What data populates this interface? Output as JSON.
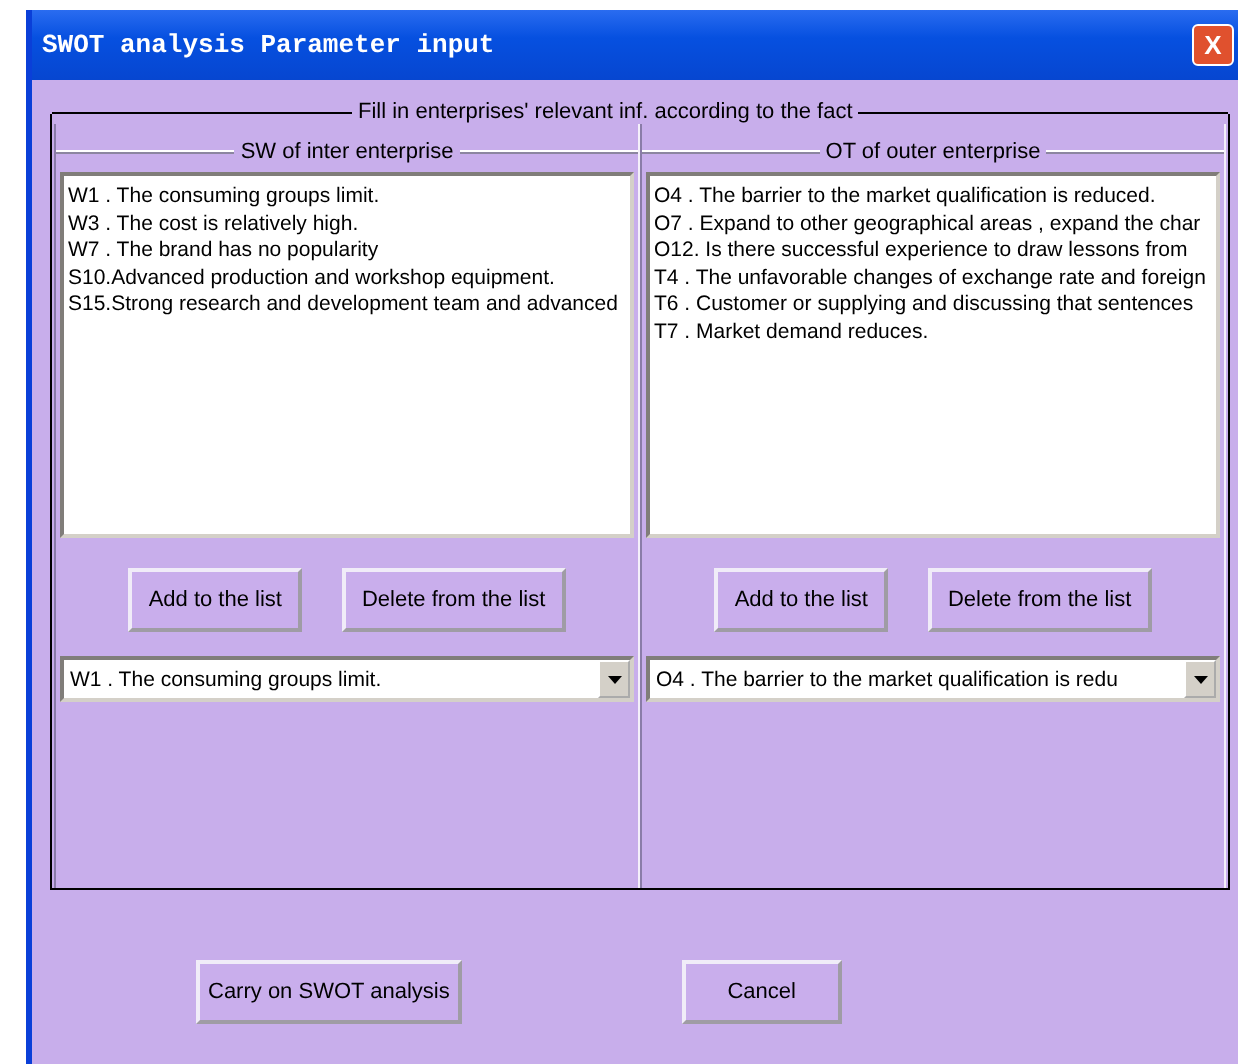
{
  "window": {
    "title": "SWOT analysis Parameter input",
    "close_label": "X"
  },
  "group": {
    "title": "Fill in enterprises' relevant inf. according to the fact"
  },
  "panels": [
    {
      "title": "SW of inter enterprise",
      "items": [
        "W1 . The consuming groups limit.",
        "W3 . The cost is relatively high.",
        "W7 . The brand has no popularity",
        "S10.Advanced production and workshop equipment.",
        "S15.Strong research and development team and advanced"
      ],
      "buttons": [
        "Add to the list",
        "Delete from the list"
      ],
      "combo": {
        "value": "W1 . The consuming groups limit."
      }
    },
    {
      "title": "OT of outer enterprise",
      "items": [
        "O4 . The barrier to the market qualification is reduced.",
        "O7 . Expand to other geographical areas , expand the char",
        "O12. Is there successful experience to draw lessons from",
        "T4 . The unfavorable changes of exchange rate and foreign",
        "T6 . Customer or supplying and discussing that sentences",
        "T7 . Market demand reduces."
      ],
      "buttons": [
        "Add to the list",
        "Delete from the list"
      ],
      "combo": {
        "value": "O4 . The barrier to the market qualification is redu"
      }
    }
  ],
  "buttons": [
    "Carry on SWOT analysis",
    "Cancel"
  ]
}
